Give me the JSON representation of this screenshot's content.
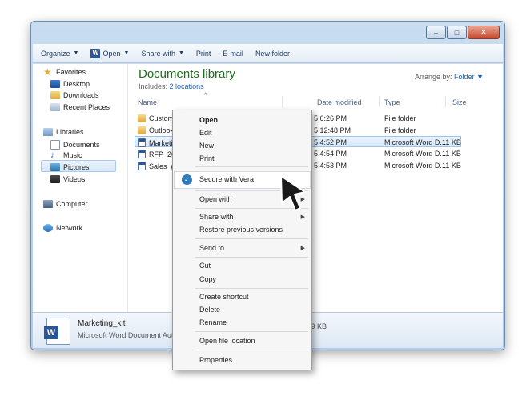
{
  "window": {
    "buttons": [
      "–",
      "□",
      "✕"
    ]
  },
  "toolbar": {
    "organize": "Organize",
    "open": "Open",
    "share": "Share with",
    "print": "Print",
    "email": "E-mail",
    "newfolder": "New folder"
  },
  "nav": {
    "favorites": "Favorites",
    "desktop": "Desktop",
    "downloads": "Downloads",
    "recent": "Recent Places",
    "libraries": "Libraries",
    "documents": "Documents",
    "music": "Music",
    "pictures": "Pictures",
    "videos": "Videos",
    "computer": "Computer",
    "network": "Network"
  },
  "library": {
    "title": "Documents library",
    "includes_prefix": "Includes:",
    "includes_link": "2 locations",
    "arrange_label": "Arrange by:",
    "arrange_value": "Folder"
  },
  "columns": {
    "name": "Name",
    "date": "Date modified",
    "type": "Type",
    "size": "Size"
  },
  "files": [
    {
      "name": "Custom",
      "date": "5 6:26 PM",
      "type": "File folder",
      "size": "",
      "icon": "folder"
    },
    {
      "name": "Outlook",
      "date": "5 12:48 PM",
      "type": "File folder",
      "size": "",
      "icon": "folder"
    },
    {
      "name": "Marketin",
      "date": "5 4:52 PM",
      "type": "Microsoft Word D...",
      "size": "11 KB",
      "icon": "word"
    },
    {
      "name": "RFP_2015",
      "date": "5 4:54 PM",
      "type": "Microsoft Word D...",
      "size": "11 KB",
      "icon": "word"
    },
    {
      "name": "Sales_go",
      "date": "5 4:53 PM",
      "type": "Microsoft Word D...",
      "size": "11 KB",
      "icon": "word"
    }
  ],
  "details": {
    "name": "Marketing_kit",
    "type": "Microsoft Word Document",
    "author": "Aut",
    "size": "e: 10.9 KB"
  },
  "context_menu": {
    "open": "Open",
    "edit": "Edit",
    "new": "New",
    "print": "Print",
    "vera": "Secure with Vera",
    "open_with": "Open with",
    "share_with": "Share with",
    "restore": "Restore previous versions",
    "send_to": "Send to",
    "cut": "Cut",
    "copy": "Copy",
    "create_shortcut": "Create shortcut",
    "delete": "Delete",
    "rename": "Rename",
    "open_location": "Open file location",
    "properties": "Properties"
  }
}
